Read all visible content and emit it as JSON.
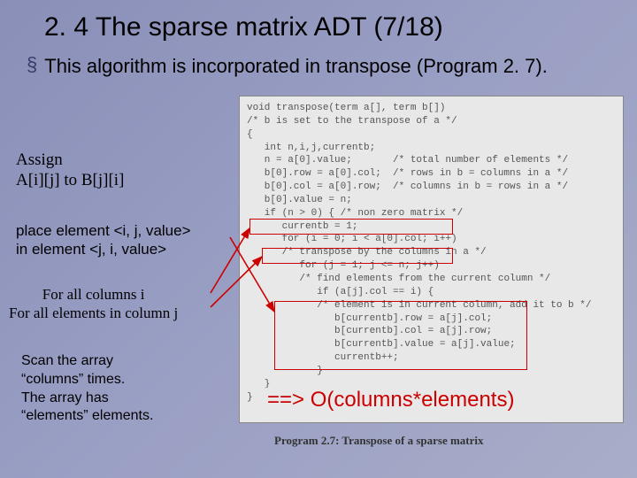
{
  "title": "2. 4 The sparse matrix ADT (7/18)",
  "bullet": {
    "marker": "§",
    "text": "This algorithm is incorporated in transpose (Program 2. 7)."
  },
  "code": "void transpose(term a[], term b[])\n/* b is set to the transpose of a */\n{\n   int n,i,j,currentb;\n   n = a[0].value;       /* total number of elements */\n   b[0].row = a[0].col;  /* rows in b = columns in a */\n   b[0].col = a[0].row;  /* columns in b = rows in a */\n   b[0].value = n;\n   if (n > 0) { /* non zero matrix */\n      currentb = 1;\n      for (i = 0; i < a[0].col; i++)\n      /* transpose by the columns in a */\n         for (j = 1; j <= n; j++)\n         /* find elements from the current column */\n            if (a[j].col == i) {\n            /* element is in current column, add it to b */\n               b[currentb].row = a[j].col;\n               b[currentb].col = a[j].row;\n               b[currentb].value = a[j].value;\n               currentb++;\n            }\n   }\n}",
  "code_caption": "Program 2.7: Transpose of a sparse matrix",
  "annotations": {
    "assign": "Assign\nA[i][j] to B[j][i]",
    "place": "place element <i, j, value>\nin element <j, i, value>",
    "loops": "For all columns i\nFor all elements in column j",
    "scan": "Scan the array\n“columns” times.\nThe array has\n“elements” elements."
  },
  "complexity": "==> O(columns*elements)"
}
